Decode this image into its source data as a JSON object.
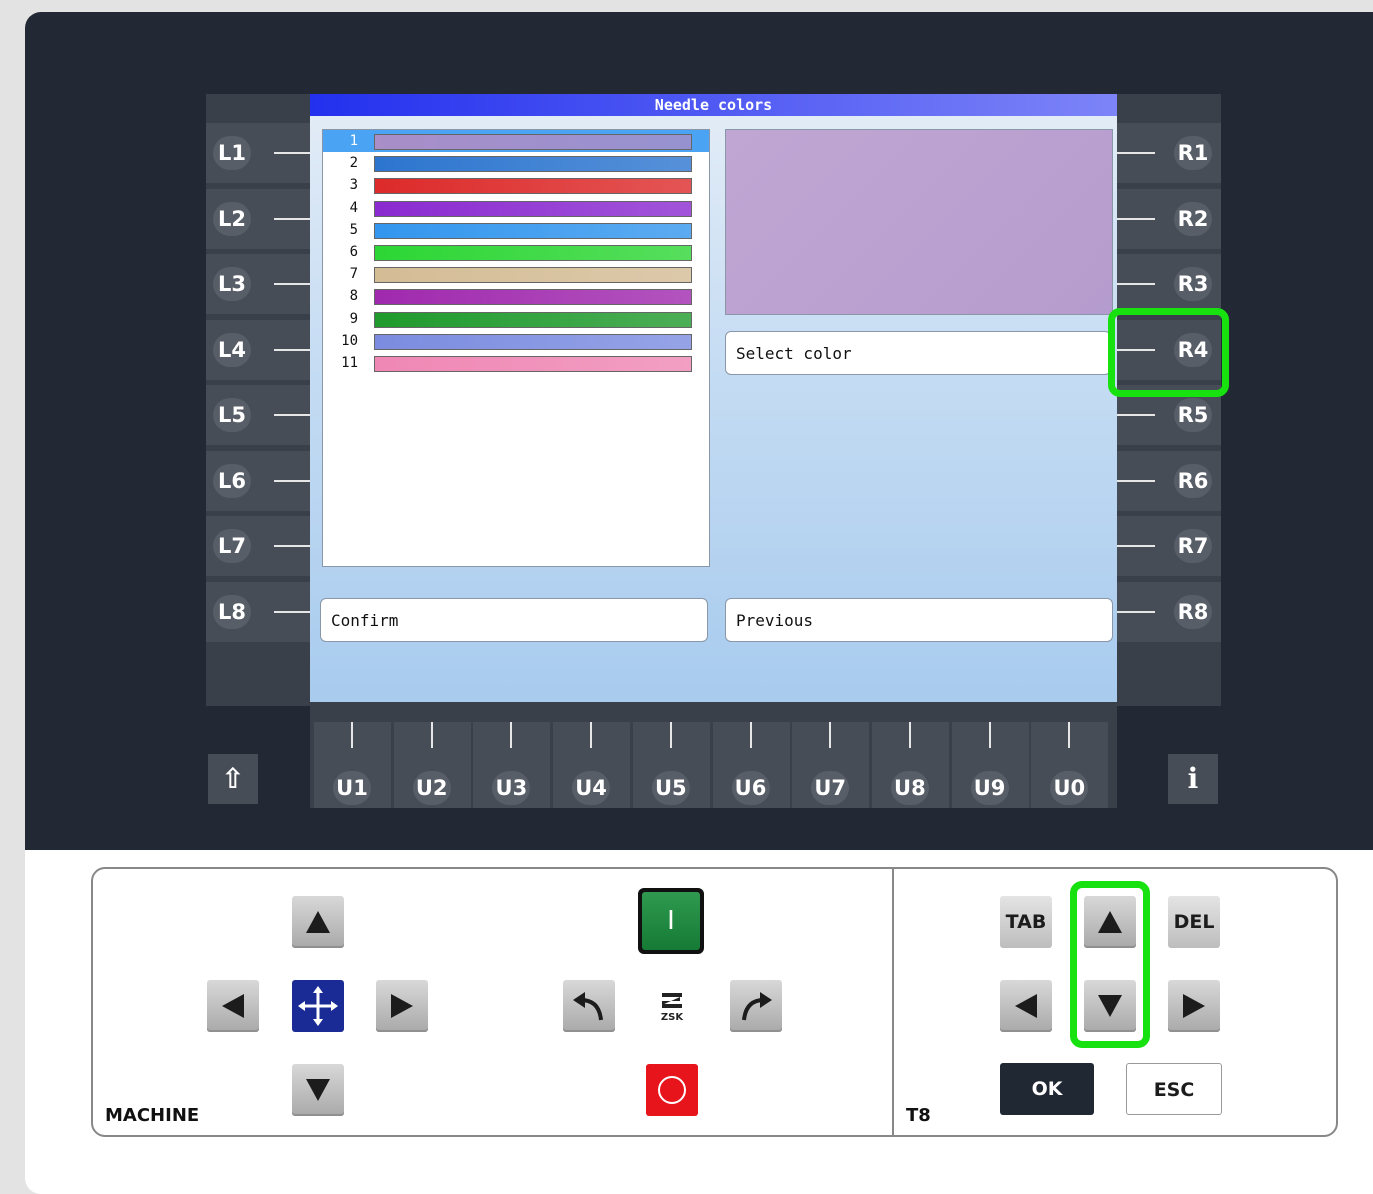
{
  "screen": {
    "title": "Needle colors",
    "needles": [
      {
        "number": "1",
        "color": "#a98ec8",
        "selected": true
      },
      {
        "number": "2",
        "color": "#2c75cf",
        "selected": false
      },
      {
        "number": "3",
        "color": "#dd2a2a",
        "selected": false
      },
      {
        "number": "4",
        "color": "#8a2ad0",
        "selected": false
      },
      {
        "number": "5",
        "color": "#3396ee",
        "selected": false
      },
      {
        "number": "6",
        "color": "#2cd634",
        "selected": false
      },
      {
        "number": "7",
        "color": "#d4bc95",
        "selected": false
      },
      {
        "number": "8",
        "color": "#a029ae",
        "selected": false
      },
      {
        "number": "9",
        "color": "#1f9a2c",
        "selected": false
      },
      {
        "number": "10",
        "color": "#7b8ce0",
        "selected": false
      },
      {
        "number": "11",
        "color": "#ef87b4",
        "selected": false
      }
    ],
    "preview_color": "#c0a6d2",
    "select_color_label": "Select color",
    "confirm_label": "Confirm",
    "previous_label": "Previous"
  },
  "left_keys": [
    "L1",
    "L2",
    "L3",
    "L4",
    "L5",
    "L6",
    "L7",
    "L8"
  ],
  "right_keys": [
    "R1",
    "R2",
    "R3",
    "R4",
    "R5",
    "R6",
    "R7",
    "R8"
  ],
  "bottom_keys": [
    "U1",
    "U2",
    "U3",
    "U4",
    "U5",
    "U6",
    "U7",
    "U8",
    "U9",
    "U0"
  ],
  "shift_symbol": "⇧",
  "info_symbol": "i",
  "machine_panel": {
    "label": "MACHINE",
    "start_symbol": "I",
    "zsk_logo": "ZSK"
  },
  "t8_panel": {
    "label": "T8",
    "tab_label": "TAB",
    "del_label": "DEL",
    "ok_label": "OK",
    "esc_label": "ESC"
  },
  "highlight_color": "#17e20f"
}
